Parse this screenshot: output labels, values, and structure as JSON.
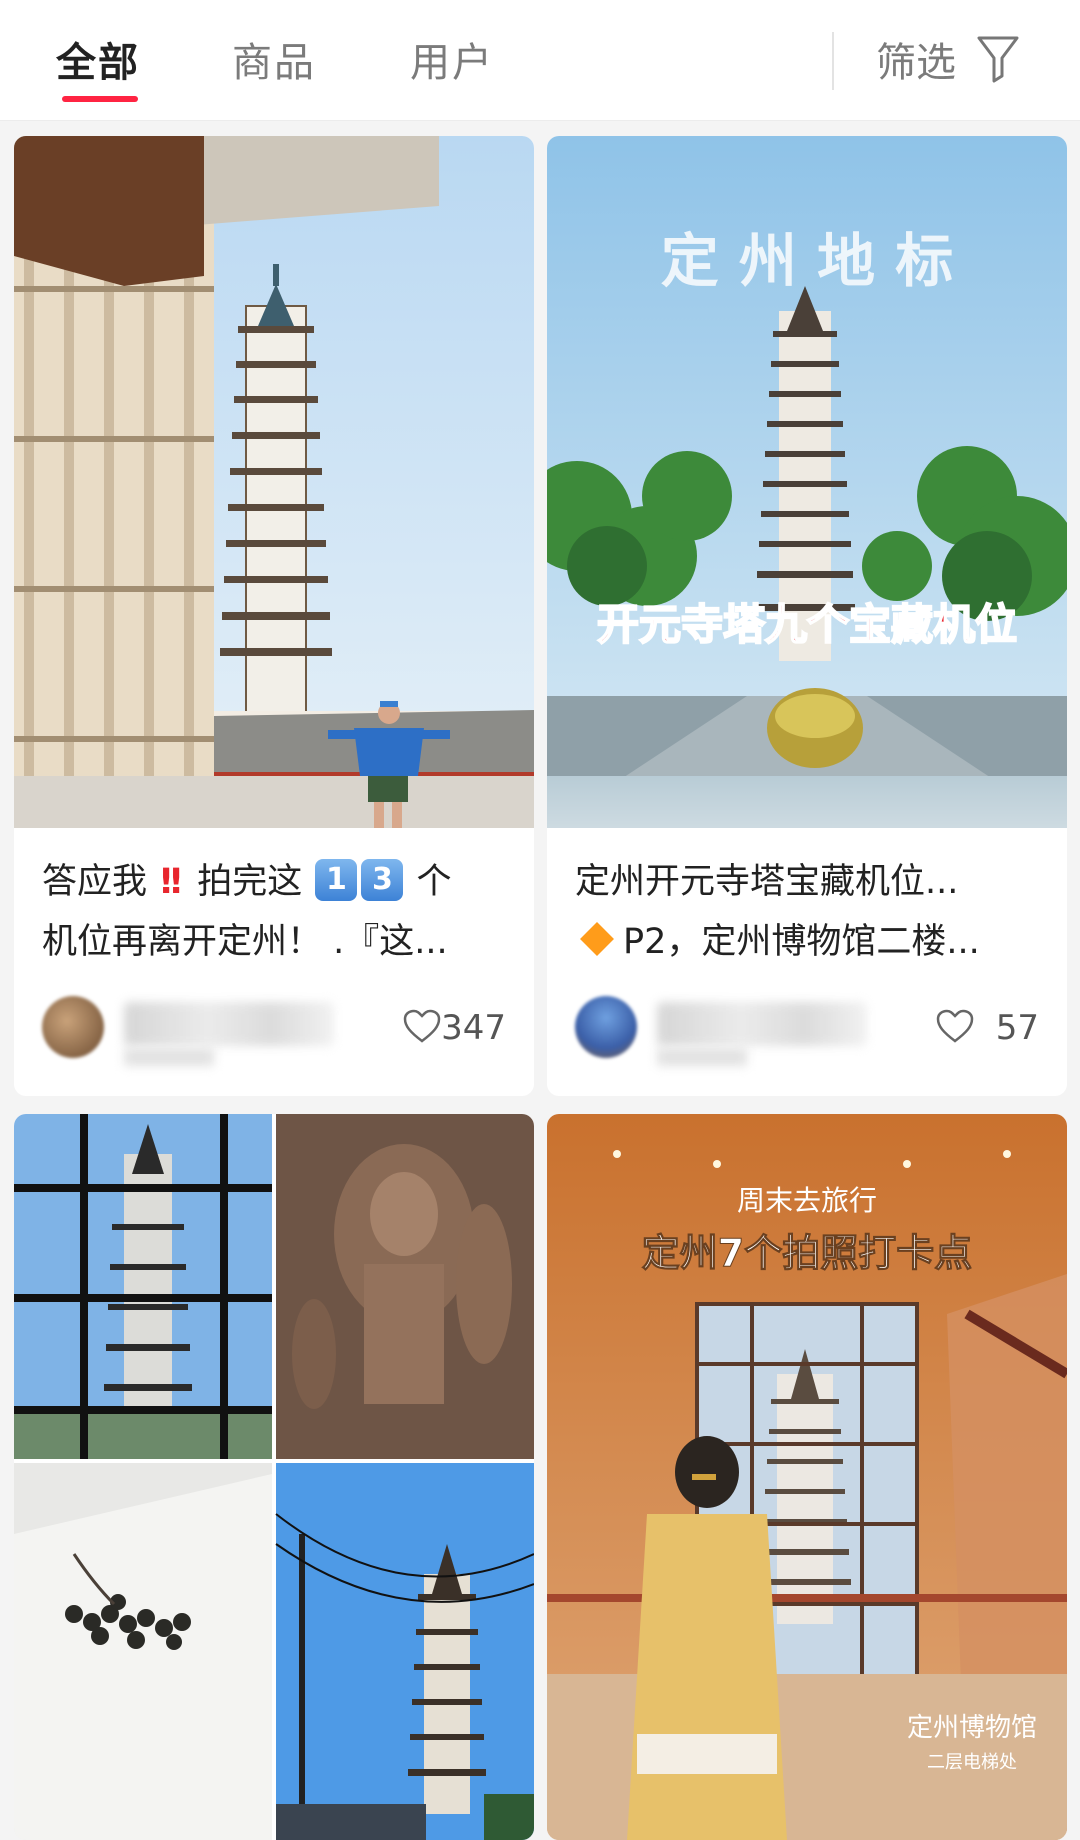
{
  "tabs": [
    {
      "label": "全部",
      "active": true
    },
    {
      "label": "商品",
      "active": false
    },
    {
      "label": "用户",
      "active": false
    }
  ],
  "filter": {
    "label": "筛选",
    "icon": "funnel-icon"
  },
  "accent_color": "#ff2442",
  "cards": [
    {
      "title_line1_a": "答应我",
      "title_line1_b": "拍完这",
      "num1": "1",
      "num2": "3",
      "title_line1_c": "个",
      "title_line2": "机位再离开定州！ .『这...",
      "likes": "347",
      "cover_overlay": ""
    },
    {
      "title_line1": "定州开元寺塔宝藏机位...",
      "title_line2": "P2，定州博物馆二楼...",
      "likes": "57",
      "cover_heading": "定 州 地 标",
      "cover_banner": "开元寺塔九个宝藏机位"
    },
    {
      "cover_overlay": ""
    },
    {
      "cover_small": "周末去旅行",
      "cover_heading": "定州7个拍照打卡点",
      "cover_sign": "定州博物馆",
      "cover_sign_sub": "二层电梯处"
    }
  ]
}
